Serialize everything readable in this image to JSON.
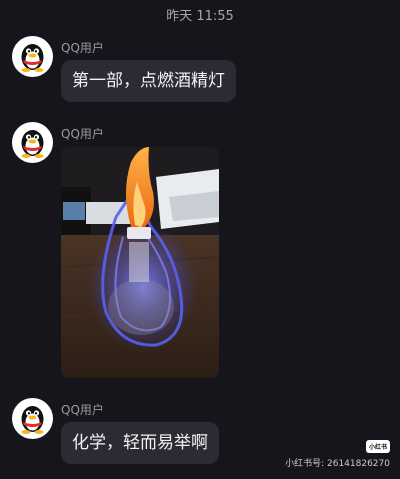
{
  "header": {
    "timestamp": "昨天 11:55"
  },
  "messages": [
    {
      "sender": "QQ用户",
      "type": "text",
      "text": "第一部，点燃酒精灯"
    },
    {
      "sender": "QQ用户",
      "type": "image",
      "image_icon": "alcohol-lamp-flame-photo"
    },
    {
      "sender": "QQ用户",
      "type": "text",
      "text": "化学，轻而易举啊"
    }
  ],
  "watermark": {
    "logo": "小红书",
    "id_text": "小红书号: 26141826270"
  },
  "colors": {
    "background": "#16151b",
    "bubble": "#2c2b33",
    "sender_text": "#9a9aa1",
    "flame_blue": "#4f58e8",
    "flame_orange": "#f59a22"
  }
}
